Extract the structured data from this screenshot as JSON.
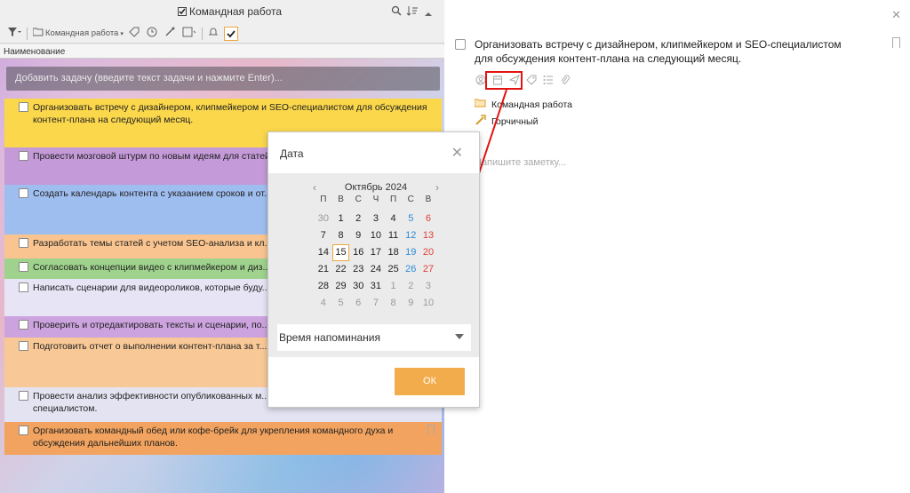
{
  "left": {
    "title": "Командная работа",
    "toolbar_folder": "Командная работа",
    "column_header": "Наименование",
    "add_task_placeholder": "Добавить задачу (введите текст задачи и нажмите Enter)...",
    "tasks": [
      {
        "text": "Организовать встречу с дизайнером, клипмейкером и SEO-специалистом для обсуждения контент-плана на следующий месяц.",
        "color": "#fbd74b"
      },
      {
        "text": "Провести мозговой штурм по новым идеям для статей",
        "color": "#c49ad8"
      },
      {
        "text": "Создать календарь контента с указанием сроков и от... контента.",
        "color": "#9fbef0"
      },
      {
        "text": "Разработать темы статей с учетом SEO-анализа и кл...",
        "color": "#f9c48f"
      },
      {
        "text": "Согласовать концепции видео с клипмейкером и диз...",
        "color": "#9fd38d"
      },
      {
        "text": "Написать сценарии для видеороликов, которые буду...",
        "color": "#e6e4f5"
      },
      {
        "text": "Проверить и отредактировать тексты и сценарии, по...",
        "color": "#cca3de"
      },
      {
        "text": "Подготовить отчет о выполнении контент-плана за т... с командой.",
        "color": "#f8c896"
      },
      {
        "text": "Провести анализ эффективности опубликованных м... комментарии) и обсудить с SEO-специалистом.",
        "color": "#e3e3f2"
      },
      {
        "text": "Организовать командный обед или кофе-брейк для укрепления командного духа и обсуждения дальнейших планов.",
        "color": "#f2a35f"
      }
    ]
  },
  "detail": {
    "title": "Организовать встречу с дизайнером, клипмейкером и SEO-специалистом для обсуждения контент-плана на следующий месяц.",
    "project": "Командная работа",
    "tag": "Горчичный",
    "note_placeholder": "Напишите заметку..."
  },
  "dialog": {
    "title": "Дата",
    "month": "Октябрь 2024",
    "weekdays": [
      "П",
      "В",
      "С",
      "Ч",
      "П",
      "С",
      "В"
    ],
    "weeks": [
      [
        "30",
        "1",
        "2",
        "3",
        "4",
        "5",
        "6"
      ],
      [
        "7",
        "8",
        "9",
        "10",
        "11",
        "12",
        "13"
      ],
      [
        "14",
        "15",
        "16",
        "17",
        "18",
        "19",
        "20"
      ],
      [
        "21",
        "22",
        "23",
        "24",
        "25",
        "26",
        "27"
      ],
      [
        "28",
        "29",
        "30",
        "31",
        "1",
        "2",
        "3"
      ],
      [
        "4",
        "5",
        "6",
        "7",
        "8",
        "9",
        "10"
      ]
    ],
    "selected_day": "15",
    "reminder_label": "Время напоминания",
    "ok_label": "ОК"
  },
  "colors": {
    "accent": "#f3ac4c",
    "saturday": "#2f8ad4",
    "sunday": "#e0403a",
    "highlight": "#e21212"
  }
}
